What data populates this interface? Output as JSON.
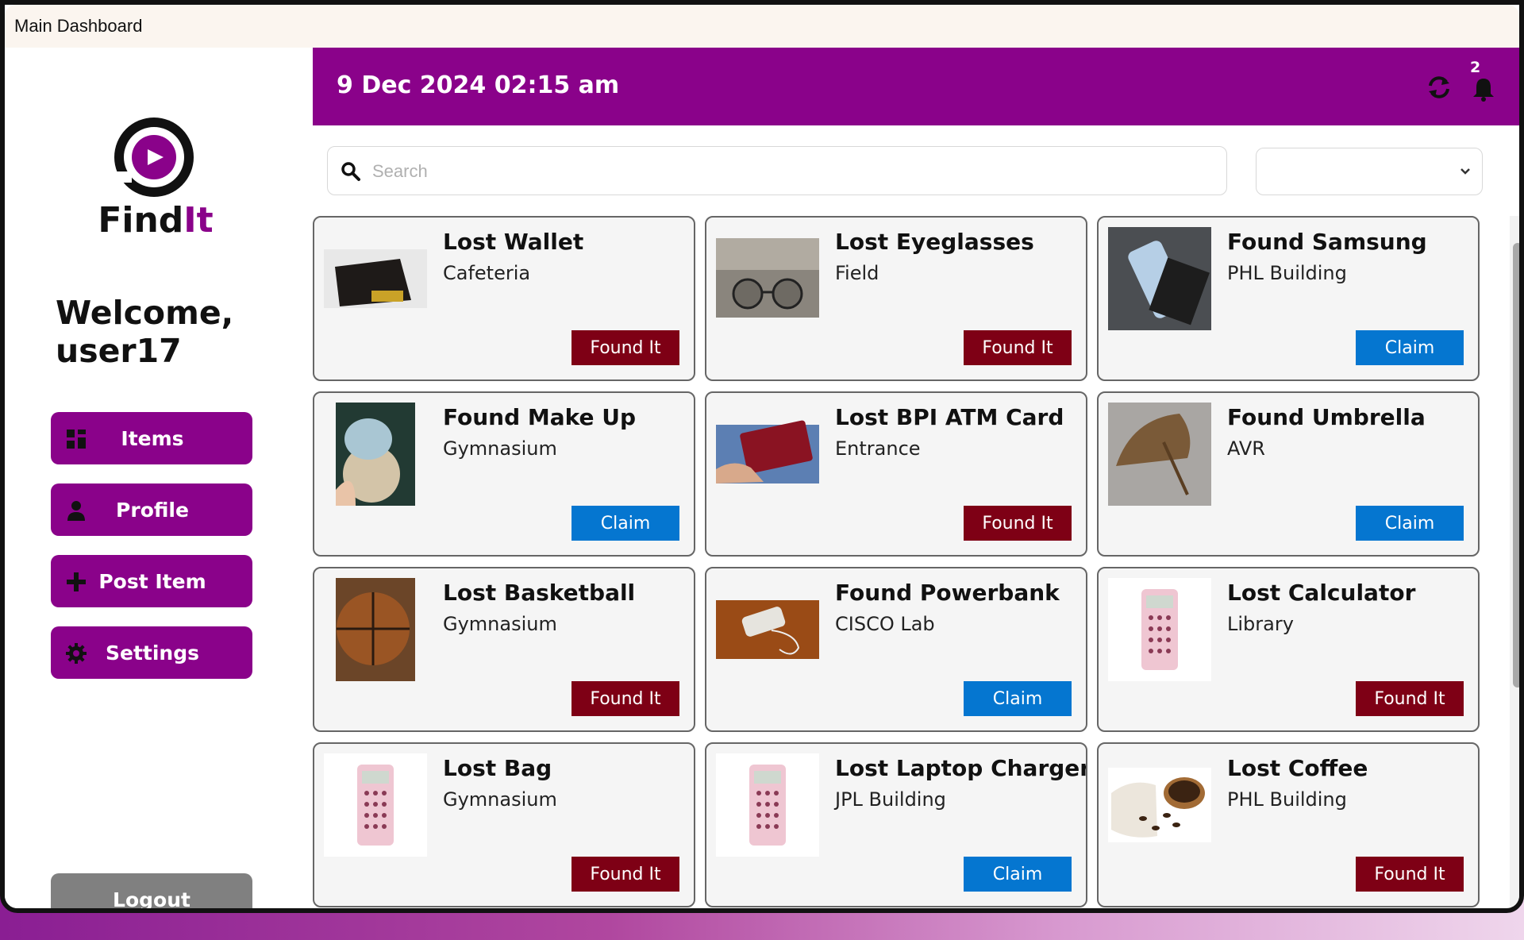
{
  "window": {
    "title": "Main Dashboard"
  },
  "brand": {
    "name": "FindIt",
    "accent": "#8a028a"
  },
  "sidebar": {
    "welcome_line1": "Welcome,",
    "welcome_line2": "user17",
    "items": [
      {
        "label": "Items",
        "icon": "grid-icon"
      },
      {
        "label": "Profile",
        "icon": "user-icon"
      },
      {
        "label": "Post Item",
        "icon": "plus-icon"
      },
      {
        "label": "Settings",
        "icon": "gear-icon"
      }
    ],
    "logout_label": "Logout"
  },
  "header": {
    "datetime": "9 Dec 2024 02:15 am",
    "notification_count": "2"
  },
  "search": {
    "placeholder": "Search",
    "value": ""
  },
  "filter": {
    "selected": ""
  },
  "cards": [
    {
      "name": "Lost Wallet",
      "location": "Cafeteria",
      "action": "Found It",
      "type": "found",
      "icon": "wallet-icon"
    },
    {
      "name": "Lost Eyeglasses",
      "location": "Field",
      "action": "Found It",
      "type": "found",
      "icon": "eyeglasses-icon"
    },
    {
      "name": "Found Samsung",
      "location": "PHL Building",
      "action": "Claim",
      "type": "claim",
      "icon": "phone-icon"
    },
    {
      "name": "Found Make Up",
      "location": "Gymnasium",
      "action": "Claim",
      "type": "claim",
      "icon": "compact-icon"
    },
    {
      "name": "Lost BPI ATM Card",
      "location": "Entrance",
      "action": "Found It",
      "type": "found",
      "icon": "card-icon"
    },
    {
      "name": "Found Umbrella",
      "location": "AVR",
      "action": "Claim",
      "type": "claim",
      "icon": "umbrella-icon"
    },
    {
      "name": "Lost Basketball",
      "location": "Gymnasium",
      "action": "Found It",
      "type": "found",
      "icon": "basketball-icon"
    },
    {
      "name": "Found Powerbank",
      "location": "CISCO Lab",
      "action": "Claim",
      "type": "claim",
      "icon": "powerbank-icon"
    },
    {
      "name": "Lost Calculator",
      "location": "Library",
      "action": "Found It",
      "type": "found",
      "icon": "calculator-icon"
    },
    {
      "name": "Lost Bag",
      "location": "Gymnasium",
      "action": "Found It",
      "type": "found",
      "icon": "calculator-icon"
    },
    {
      "name": "Lost Laptop Charger",
      "location": "JPL Building",
      "action": "Claim",
      "type": "claim",
      "icon": "calculator-icon"
    },
    {
      "name": "Lost Coffee",
      "location": "PHL Building",
      "action": "Found It",
      "type": "found",
      "icon": "coffee-icon"
    }
  ],
  "colors": {
    "found": "#7e0015",
    "claim": "#0576d0",
    "header": "#8a028a"
  }
}
